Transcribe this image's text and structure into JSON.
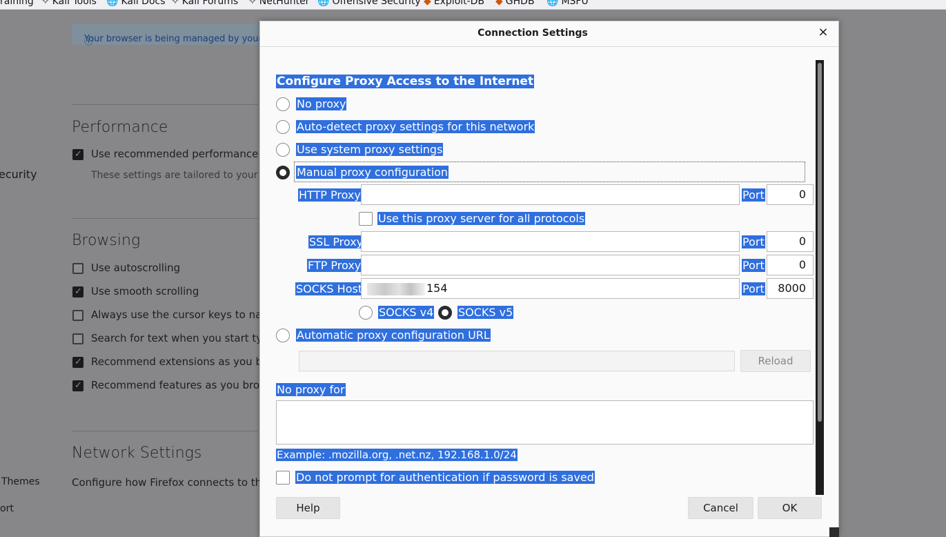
{
  "bookmarks": [
    {
      "label": "raining",
      "icon": ""
    },
    {
      "label": "Kali Tools",
      "icon": "kali-icon"
    },
    {
      "label": "Kali Docs",
      "icon": "globe-icon"
    },
    {
      "label": "Kali Forums",
      "icon": "kali-icon"
    },
    {
      "label": "NetHunter",
      "icon": "kali-icon"
    },
    {
      "label": "Offensive Security",
      "icon": "globe-icon"
    },
    {
      "label": "Exploit-DB",
      "icon": "exploitdb-icon"
    },
    {
      "label": "GHDB",
      "icon": "exploitdb-icon"
    },
    {
      "label": "MSFU",
      "icon": "globe-icon"
    }
  ],
  "background": {
    "managed_notice": "Your browser is being managed by your",
    "sidebar": {
      "security": "ecurity",
      "themes": "Themes",
      "support": "ort"
    },
    "performance": {
      "heading": "Performance",
      "use_recommended": "Use recommended performance s",
      "tailored": "These settings are tailored to your con"
    },
    "browsing": {
      "heading": "Browsing",
      "autoscrolling": "Use autoscrolling",
      "smooth": "Use smooth scrolling",
      "cursor_keys": "Always use the cursor keys to nav",
      "search_text": "Search for text when you start typ",
      "recommend_ext": "Recommend extensions as you br",
      "recommend_feat": "Recommend features as you brow"
    },
    "network": {
      "heading": "Network Settings",
      "configure": "Configure how Firefox connects to the"
    }
  },
  "dialog": {
    "title": "Connection Settings",
    "close": "×",
    "heading": "Configure Proxy Access to the Internet",
    "options": {
      "no_proxy": "No proxy",
      "auto_detect": "Auto-detect proxy settings for this network",
      "system": "Use system proxy settings",
      "manual": "Manual proxy configuration",
      "auto_url": "Automatic proxy configuration URL"
    },
    "selected_option": "manual",
    "http_proxy": {
      "label": "HTTP Proxy",
      "value": "",
      "port_label": "Port",
      "port": "0"
    },
    "use_for_all": "Use this proxy server for all protocols",
    "ssl_proxy": {
      "label": "SSL Proxy",
      "value": "",
      "port_label": "Port",
      "port": "0"
    },
    "ftp_proxy": {
      "label": "FTP Proxy",
      "value": "",
      "port_label": "Port",
      "port": "0"
    },
    "socks_host": {
      "label": "SOCKS Host",
      "value": "154",
      "port_label": "Port",
      "port": "8000"
    },
    "socks_v4": "SOCKS v4",
    "socks_v5": "SOCKS v5",
    "socks_version_selected": "v5",
    "auto_url_value": "",
    "reload": "Reload",
    "no_proxy_for_label": "No proxy for",
    "no_proxy_for_value": "",
    "example": "Example: .mozilla.org, .net.nz, 192.168.1.0/24",
    "no_prompt_auth": "Do not prompt for authentication if password is saved",
    "buttons": {
      "help": "Help",
      "cancel": "Cancel",
      "ok": "OK"
    }
  },
  "colors": {
    "selection": "#2f6fde",
    "dialog_bg": "#fafafa",
    "overlay": "#878789"
  }
}
